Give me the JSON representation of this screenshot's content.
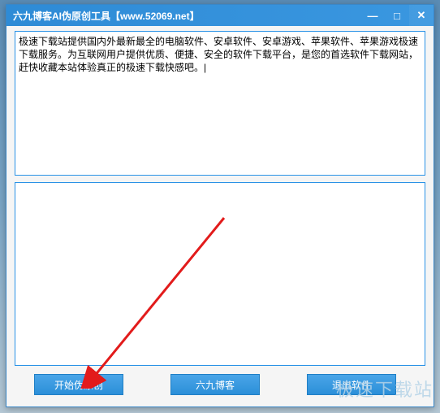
{
  "window": {
    "title": "六九博客AI伪原创工具【www.52069.net】"
  },
  "controls": {
    "minimize": "—",
    "maximize": "□",
    "close": "✕"
  },
  "input": {
    "text": "极速下载站提供国内外最新最全的电脑软件、安卓软件、安卓游戏、苹果软件、苹果游戏极速下载服务。为互联网用户提供优质、便捷、安全的软件下载平台，是您的首选软件下载网站，赶快收藏本站体验真正的极速下载快感吧。|"
  },
  "output": {
    "text": ""
  },
  "buttons": {
    "start": "开始伪原创",
    "blog": "六九博客",
    "exit": "退出软件"
  },
  "watermark": "极速下载站"
}
